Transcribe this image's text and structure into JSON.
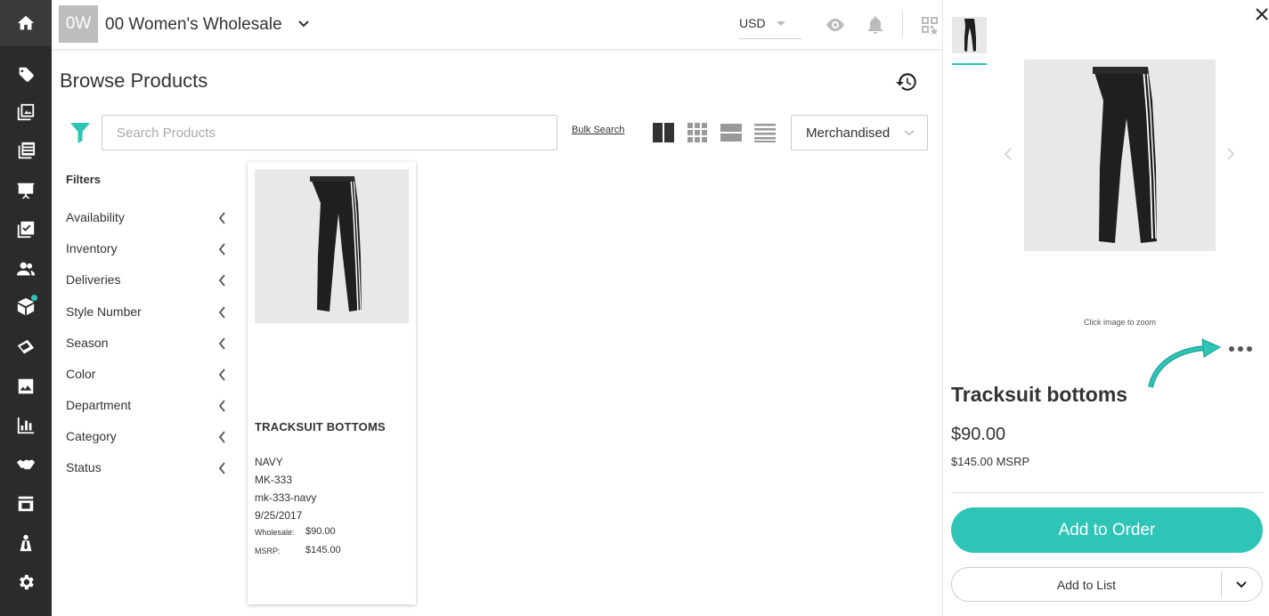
{
  "header": {
    "avatar_initials": "0W",
    "store_name": "00 Women's Wholesale",
    "currency": "USD"
  },
  "main": {
    "title": "Browse Products",
    "search_placeholder": "Search Products",
    "bulk_search": "Bulk Search",
    "sort_value": "Merchandised"
  },
  "filters": {
    "title": "Filters",
    "items": [
      "Availability",
      "Inventory",
      "Deliveries",
      "Style Number",
      "Season",
      "Color",
      "Department",
      "Category",
      "Status"
    ]
  },
  "product_card": {
    "name": "TRACKSUIT BOTTOMS",
    "color": "NAVY",
    "style": "MK-333",
    "sku": "mk-333-navy",
    "date": "9/25/2017",
    "wholesale_label": "Wholesale:",
    "wholesale_value": "$90.00",
    "msrp_label": "MSRP:",
    "msrp_value": "$145.00"
  },
  "detail": {
    "zoom_hint": "Click image to zoom",
    "name": "Tracksuit bottoms",
    "price": "$90.00",
    "msrp": "$145.00 MSRP",
    "add_order": "Add to Order",
    "add_list": "Add to List"
  },
  "colors": {
    "rail": "#2b2b2b",
    "accent": "#2ec4b6"
  }
}
